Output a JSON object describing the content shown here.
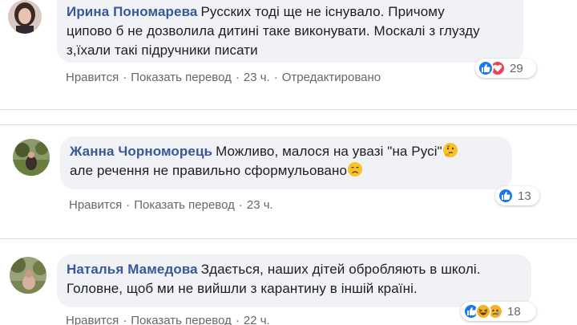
{
  "comments": [
    {
      "author": "Ирина Пономарева",
      "text_lines": [
        "Русских тоді ще не існувало. Причому",
        "ципово б не дозволила дитині таке виконувати. Москалі з глузду",
        "з,їхали такі підручники писати"
      ],
      "reaction_icons": [
        "like-reaction",
        "love-reaction"
      ],
      "reaction_count": "29",
      "like_label": "Нравится",
      "translate_label": "Показать перевод",
      "time": "23 ч.",
      "edited_label": "Отредактировано"
    },
    {
      "author": "Жанна Чорноморець",
      "text_lines": [
        "Можливо, малося на увазі \"на Русі\"",
        "але речення не правильно сформульовано"
      ],
      "emojis": [
        "thinking-face",
        "disappointed-face"
      ],
      "reaction_icons": [
        "like-reaction"
      ],
      "reaction_count": "13",
      "like_label": "Нравится",
      "translate_label": "Показать перевод",
      "time": "23 ч."
    },
    {
      "author": "Наталья Мамедова",
      "text_lines": [
        "Здається, наших дітей обробляють в школі.",
        "Головне, щоб ми не вийшли з карантину в іншій країні."
      ],
      "reaction_icons": [
        "like-reaction",
        "haha-reaction",
        "sad-reaction"
      ],
      "reaction_count": "18",
      "like_label": "Нравится",
      "translate_label": "Показать перевод",
      "time": "22 ч."
    }
  ],
  "separator": "·",
  "colors": {
    "author": "#385898",
    "bubble": "#f0f2f5",
    "meta": "#65676b",
    "like": "#1877f2",
    "love": "#f33e58",
    "haha": "#f7b125"
  }
}
